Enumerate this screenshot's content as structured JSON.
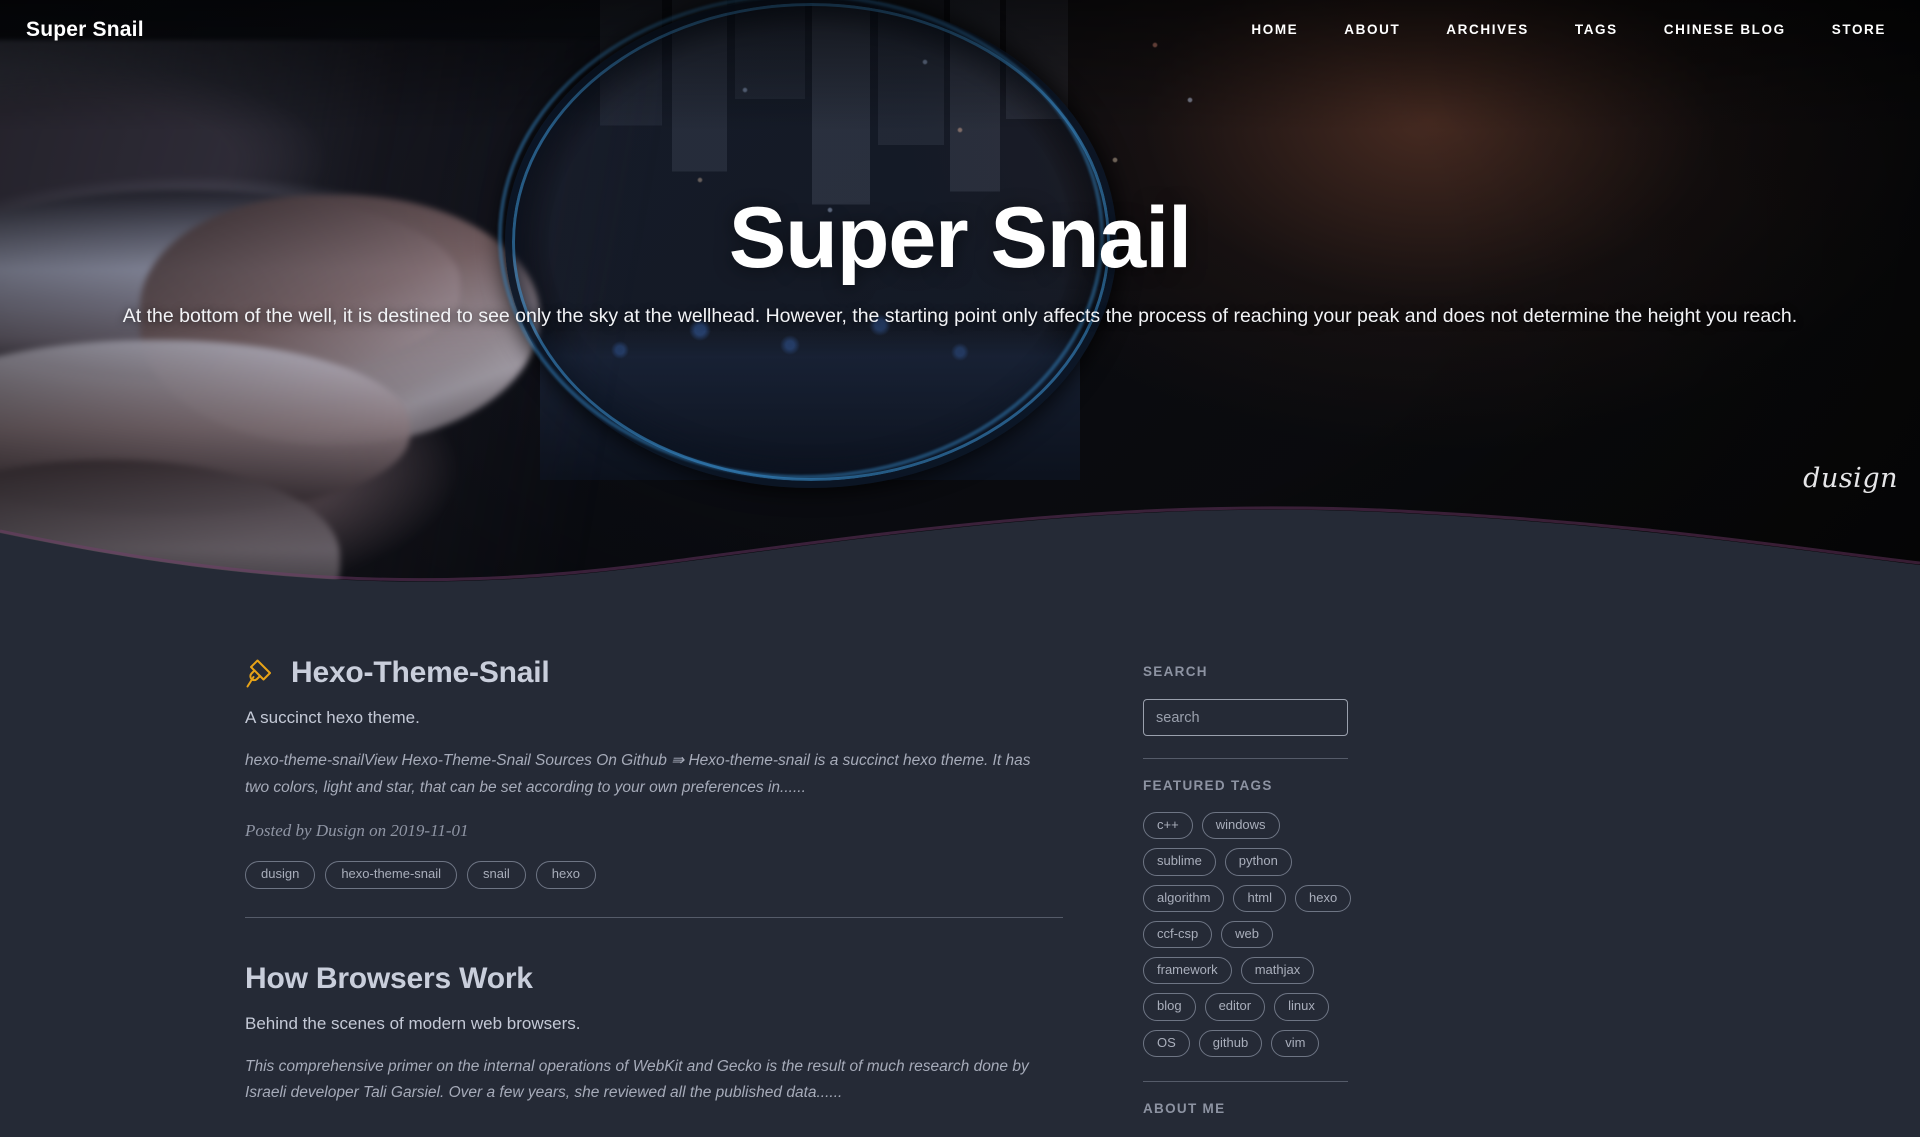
{
  "site": {
    "brand": "Super Snail",
    "signature": "dusign"
  },
  "nav": {
    "items": [
      {
        "label": "HOME",
        "name": "nav-home"
      },
      {
        "label": "ABOUT",
        "name": "nav-about"
      },
      {
        "label": "ARCHIVES",
        "name": "nav-archives"
      },
      {
        "label": "TAGS",
        "name": "nav-tags"
      },
      {
        "label": "CHINESE BLOG",
        "name": "nav-chinese-blog"
      },
      {
        "label": "STORE",
        "name": "nav-store"
      }
    ]
  },
  "hero": {
    "title": "Super Snail",
    "subtitle": "At the bottom of the well, it is destined to see only the sky at the wellhead. However, the starting point only affects the process of reaching your peak and does not determine the height you reach."
  },
  "posts": [
    {
      "pinned": true,
      "pin_icon": "pushpin-icon",
      "pin_color": "#e8a317",
      "title": "Hexo-Theme-Snail",
      "subtitle": "A succinct hexo theme.",
      "excerpt": "hexo-theme-snailView Hexo-Theme-Snail Sources On Github ⇛ Hexo-theme-snail is a succinct hexo theme. It has two colors, light and star, that can be set according to your own preferences in......",
      "meta": "Posted by Dusign on 2019-11-01",
      "tags": [
        "dusign",
        "hexo-theme-snail",
        "snail",
        "hexo"
      ]
    },
    {
      "pinned": false,
      "title": "How Browsers Work",
      "subtitle": "Behind the scenes of modern web browsers.",
      "excerpt": "This comprehensive primer on the internal operations of WebKit and Gecko is the result of much research done by Israeli developer Tali Garsiel. Over a few years, she reviewed all the published data......",
      "meta": "",
      "tags": []
    }
  ],
  "sidebar": {
    "search": {
      "heading": "SEARCH",
      "placeholder": "search",
      "value": ""
    },
    "featured_tags": {
      "heading": "FEATURED TAGS",
      "tags": [
        "c++",
        "windows",
        "sublime",
        "python",
        "algorithm",
        "html",
        "hexo",
        "ccf-csp",
        "web",
        "framework",
        "mathjax",
        "blog",
        "editor",
        "linux",
        "OS",
        "github",
        "vim"
      ]
    },
    "about_me": {
      "heading": "ABOUT ME"
    }
  },
  "colors": {
    "page_background": "#252a36",
    "text_primary": "#c9cedb",
    "text_muted": "#8d93a2",
    "tag_border": "#6e7584",
    "accent_pin": "#e8a317"
  }
}
